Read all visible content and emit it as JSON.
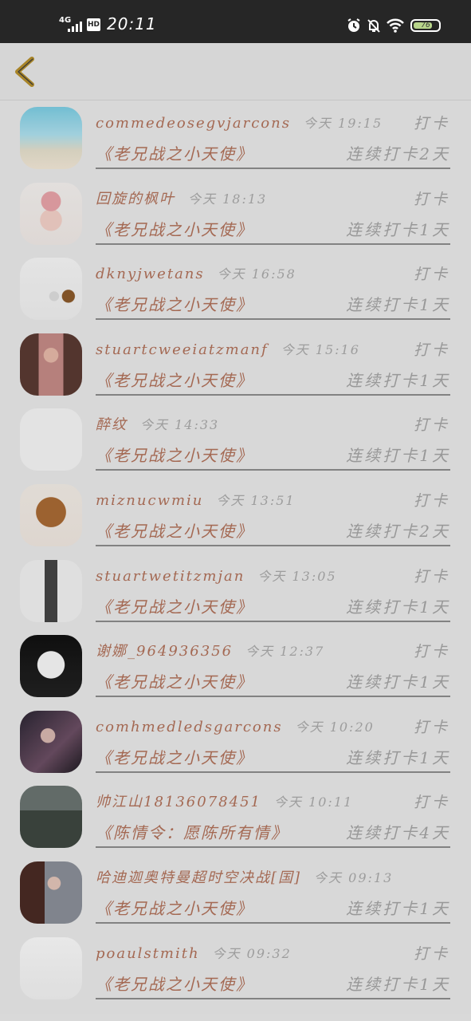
{
  "status_bar": {
    "network": "4G",
    "hd": "HD",
    "time": "20:11",
    "battery": "76",
    "battery_level": 0.76
  },
  "header": {
    "back_icon": "chevron-left-icon",
    "accent": "#b58f2c"
  },
  "list": [
    {
      "username": "commedeosegvjarcons",
      "time": "今天 19:15",
      "action": "打卡",
      "book": "《老兄战之小天使》",
      "streak": "连续打卡2天",
      "avatar": "beach"
    },
    {
      "username": "回旋的枫叶",
      "time": "今天 18:13",
      "action": "打卡",
      "book": "《老兄战之小天使》",
      "streak": "连续打卡1天",
      "avatar": "girl-flower"
    },
    {
      "username": "dknyjwetans",
      "time": "今天 16:58",
      "action": "打卡",
      "book": "《老兄战之小天使》",
      "streak": "连续打卡1天",
      "avatar": "bears"
    },
    {
      "username": "stuartcweeiatzmanf",
      "time": "今天 15:16",
      "action": "打卡",
      "book": "《老兄战之小天使》",
      "streak": "连续打卡1天",
      "avatar": "woman-hair"
    },
    {
      "username": "醉纹",
      "time": "今天 14:33",
      "action": "打卡",
      "book": "《老兄战之小天使》",
      "streak": "连续打卡1天",
      "avatar": "sketch-hearts"
    },
    {
      "username": "miznucwmiu",
      "time": "今天 13:51",
      "action": "打卡",
      "book": "《老兄战之小天使》",
      "streak": "连续打卡2天",
      "avatar": "dog"
    },
    {
      "username": "stuartwetitzmjan",
      "time": "今天 13:05",
      "action": "打卡",
      "book": "《老兄战之小天使》",
      "streak": "连续打卡1天",
      "avatar": "chair-figure"
    },
    {
      "username": "谢娜_964936356",
      "time": "今天 12:37",
      "action": "打卡",
      "book": "《老兄战之小天使》",
      "streak": "连续打卡1天",
      "avatar": "white-dog"
    },
    {
      "username": "comhmedledsgarcons",
      "time": "今天 10:20",
      "action": "打卡",
      "book": "《老兄战之小天使》",
      "streak": "连续打卡1天",
      "avatar": "woman-dark"
    },
    {
      "username": "帅江山18136078451",
      "time": "今天 10:11",
      "action": "打卡",
      "book": "《陈情令：愿陈所有情》",
      "streak": "连续打卡4天",
      "avatar": "street"
    },
    {
      "username": "哈迪迦奥特曼超时空决战[国]",
      "time": "今天 09:13",
      "action": "",
      "book": "《老兄战之小天使》",
      "streak": "连续打卡1天",
      "avatar": "woman-window"
    },
    {
      "username": "poaulstmith",
      "time": "今天 09:32",
      "action": "打卡",
      "book": "《老兄战之小天使》",
      "streak": "连续打卡1天",
      "avatar": "sketch-face"
    }
  ]
}
